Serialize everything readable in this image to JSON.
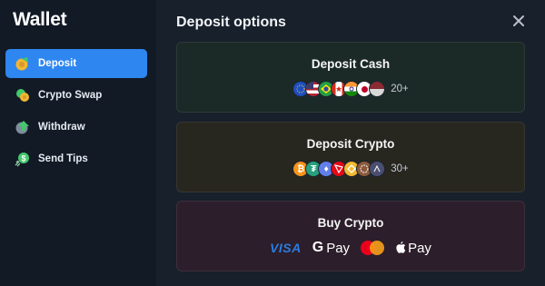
{
  "sidebar": {
    "title": "Wallet",
    "items": [
      {
        "label": "Deposit",
        "icon": "deposit-icon",
        "active": true
      },
      {
        "label": "Crypto Swap",
        "icon": "crypto-swap-icon",
        "active": false
      },
      {
        "label": "Withdraw",
        "icon": "withdraw-icon",
        "active": false
      },
      {
        "label": "Send Tips",
        "icon": "send-tips-icon",
        "active": false
      }
    ]
  },
  "main": {
    "title": "Deposit options",
    "close_icon": "close-icon",
    "cards": [
      {
        "title": "Deposit Cash",
        "count": "20+",
        "icons": [
          "eu-flag-icon",
          "us-flag-icon",
          "brazil-flag-icon",
          "canada-flag-icon",
          "india-flag-icon",
          "japan-flag-icon",
          "generic-flag-icon"
        ]
      },
      {
        "title": "Deposit Crypto",
        "count": "30+",
        "icons": [
          "bitcoin-icon",
          "tether-icon",
          "ethereum-icon",
          "tron-icon",
          "bnb-icon",
          "generic-coin-icon",
          "generic-coin-icon"
        ]
      },
      {
        "title": "Buy Crypto",
        "payments": [
          "VISA",
          "Pay",
          "mastercard-icon",
          "Pay"
        ]
      }
    ]
  },
  "colors": {
    "accent": "#2e86f0",
    "card_cash": "#1c2a27",
    "card_crypto": "#27261f",
    "card_buy": "#2c1e2a"
  }
}
